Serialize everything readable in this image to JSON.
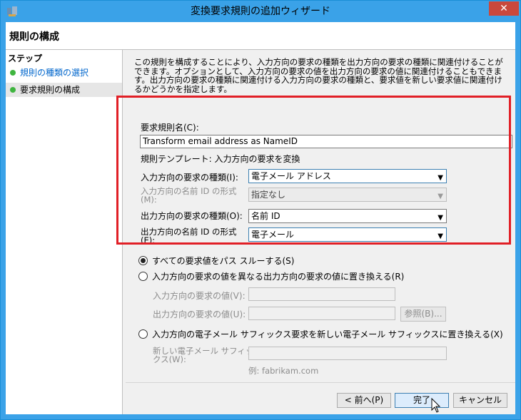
{
  "window": {
    "title": "変換要求規則の追加ウィザード",
    "close_label": "✕"
  },
  "header": {
    "title": "規則の構成"
  },
  "steps": {
    "title": "ステップ",
    "items": [
      {
        "label": "規則の種類の選択"
      },
      {
        "label": "要求規則の構成"
      }
    ]
  },
  "main": {
    "description": "この規則を構成することにより、入力方向の要求の種類を出力方向の要求の種類に関連付けることができます。オプションとして、入力方向の要求の値を出力方向の要求の値に関連付けることもできます。出力方向の要求の種類に関連付ける入力方向の要求の種類と、要求値を新しい要求値に関連付けるかどうかを指定します。",
    "rule_name_label": "要求規則名(C):",
    "rule_name_value": "Transform email address as NameID",
    "rule_template": "規則テンプレート: 入力方向の要求を変換",
    "incoming_claim_type_label": "入力方向の要求の種類(I):",
    "incoming_claim_type_value": "電子メール アドレス",
    "incoming_name_id_format_label": "入力方向の名前 ID の形式\n(M):",
    "incoming_name_id_format_value": "指定なし",
    "outgoing_claim_type_label": "出力方向の要求の種類(O):",
    "outgoing_claim_type_value": "名前 ID",
    "outgoing_name_id_format_label": "出力方向の名前 ID の形式\n(E):",
    "outgoing_name_id_format_value": "電子メール",
    "radio_pass_through": "すべての要求値をパス スルーする(S)",
    "radio_replace_value": "入力方向の要求の値を異なる出力方向の要求の値に置き換える(R)",
    "incoming_claim_value_label": "入力方向の要求の値(V):",
    "outgoing_claim_value_label": "出力方向の要求の値(U):",
    "browse_button": "参照(B)...",
    "radio_replace_suffix": "入力方向の電子メール サフィックス要求を新しい電子メール サフィックスに置き換える(X)",
    "new_suffix_label": "新しい電子メール サフィッ\nクス(W):",
    "suffix_example": "例: fabrikam.com"
  },
  "footer": {
    "back_button": "< 前へ(P)",
    "finish_button": "完了",
    "cancel_button": "キャンセル"
  },
  "colors": {
    "title_bar": "#3aa2e8",
    "highlight_box": "#e11f26",
    "close_button": "#c9483c",
    "step_done_dot": "#3fb53f"
  }
}
